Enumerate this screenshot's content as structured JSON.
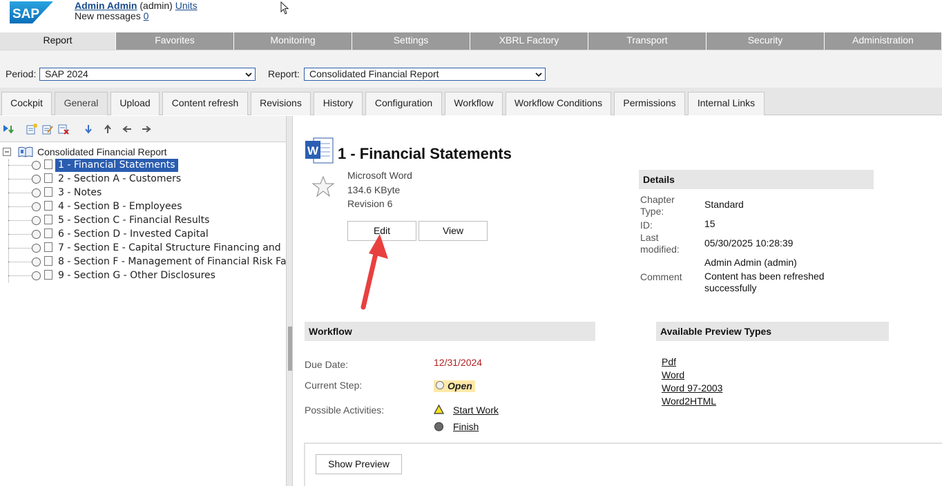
{
  "header": {
    "logo_text": "SAP",
    "user_name": "Admin Admin",
    "user_role": "(admin)",
    "units_link": "Units",
    "messages_label": "New messages",
    "messages_count": "0"
  },
  "main_tabs": [
    {
      "label": "Report",
      "active": true
    },
    {
      "label": "Favorites"
    },
    {
      "label": "Monitoring"
    },
    {
      "label": "Settings"
    },
    {
      "label": "XBRL Factory"
    },
    {
      "label": "Transport"
    },
    {
      "label": "Security"
    },
    {
      "label": "Administration"
    }
  ],
  "period": {
    "label": "Period:",
    "value": "SAP 2024"
  },
  "report": {
    "label": "Report:",
    "value": "Consolidated Financial Report"
  },
  "sub_tabs": [
    {
      "label": "Cockpit"
    },
    {
      "label": "General",
      "active": true
    },
    {
      "label": "Upload"
    },
    {
      "label": "Content refresh"
    },
    {
      "label": "Revisions"
    },
    {
      "label": "History"
    },
    {
      "label": "Configuration"
    },
    {
      "label": "Workflow"
    },
    {
      "label": "Workflow Conditions"
    },
    {
      "label": "Permissions"
    },
    {
      "label": "Internal Links"
    }
  ],
  "toolbar_icons": [
    "expand-all-icon",
    "new-chapter-icon",
    "edit-chapter-icon",
    "delete-chapter-icon",
    "move-down-icon",
    "move-up-icon",
    "move-left-icon",
    "move-right-icon"
  ],
  "tree": {
    "root": "Consolidated Financial Report",
    "items": [
      "1 - Financial Statements",
      "2 - Section A - Customers",
      "3 - Notes",
      "4 - Section B - Employees",
      "5 - Section C - Financial Results",
      "6 - Section D - Invested Capital",
      "7 - Section E - Capital Structure Financing and",
      "8 - Section F - Management of Financial Risk Fa",
      "9 - Section G - Other Disclosures"
    ],
    "selected_index": 0
  },
  "document": {
    "title": "1 - Financial Statements",
    "type": "Microsoft Word",
    "size": "134.6 KByte",
    "revision": "Revision 6",
    "edit_label": "Edit",
    "view_label": "View"
  },
  "details": {
    "heading": "Details",
    "chapter_type_label_1": "Chapter",
    "chapter_type_label_2": "Type:",
    "chapter_type": "Standard",
    "id_label": "ID:",
    "id": "15",
    "last_modified_label_1": "Last",
    "last_modified_label_2": "modified:",
    "last_modified": "05/30/2025 10:28:39",
    "modified_by": "Admin Admin (admin)",
    "comment_label": "Comment",
    "comment_1": "Content has been refreshed",
    "comment_2": "successfully"
  },
  "workflow": {
    "heading": "Workflow",
    "due_label": "Due Date:",
    "due_date": "12/31/2024",
    "step_label": "Current Step:",
    "step": "Open",
    "activities_label": "Possible Activities:",
    "activities": [
      "Start Work",
      "Finish"
    ]
  },
  "preview": {
    "heading": "Available Preview Types",
    "types": [
      "Pdf",
      "Word",
      "Word 97-2003",
      "Word2HTML"
    ],
    "show_label": "Show Preview"
  },
  "colors": {
    "accent": "#2a5db0",
    "tab_bg": "#9a9a9a",
    "due_date": "#b22020",
    "arrow": "#e8403f"
  }
}
